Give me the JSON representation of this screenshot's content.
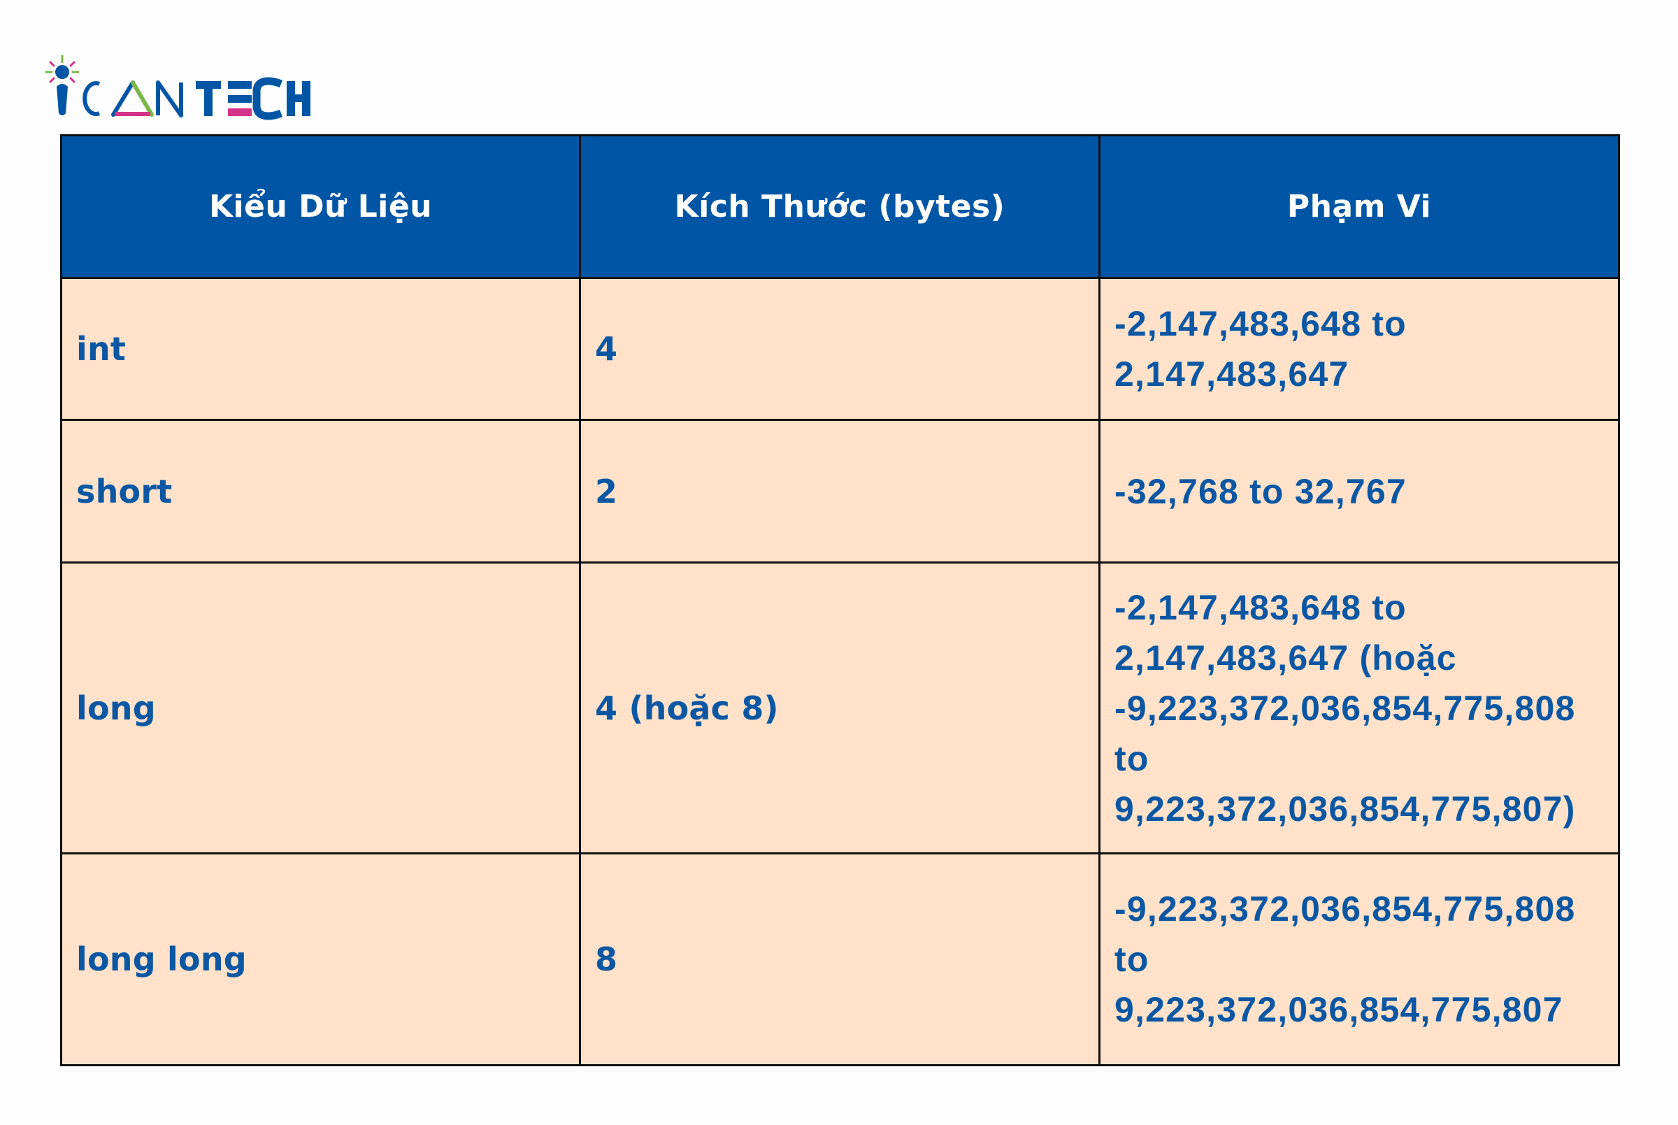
{
  "brand": {
    "logo_text_light": "ICAN",
    "logo_text_bold": "TECH",
    "logo_icon": "lightbulb-person-icon",
    "colors": {
      "blue": "#0056a5",
      "green": "#7ab648",
      "pink": "#d4338a"
    }
  },
  "table": {
    "colors": {
      "header_bg": "#0056a5",
      "header_text": "#ffffff",
      "cell_bg": "#ffe2c9",
      "cell_text": "#0b57a4",
      "border": "#111111"
    },
    "headers": [
      "Kiểu Dữ Liệu",
      "Kích Thước (bytes)",
      "Phạm Vi"
    ],
    "rows": [
      {
        "type": "int",
        "size": "4",
        "range": "-2,147,483,648 to\n2,147,483,647"
      },
      {
        "type": "short",
        "size": "2",
        "range": "-32,768 to 32,767"
      },
      {
        "type": "long",
        "size": "4 (hoặc 8)",
        "range": "-2,147,483,648 to\n2,147,483,647 (hoặc\n-9,223,372,036,854,775,808\nto\n9,223,372,036,854,775,807)"
      },
      {
        "type": "long long",
        "size": "8",
        "range": "-9,223,372,036,854,775,808\nto\n9,223,372,036,854,775,807"
      }
    ]
  }
}
